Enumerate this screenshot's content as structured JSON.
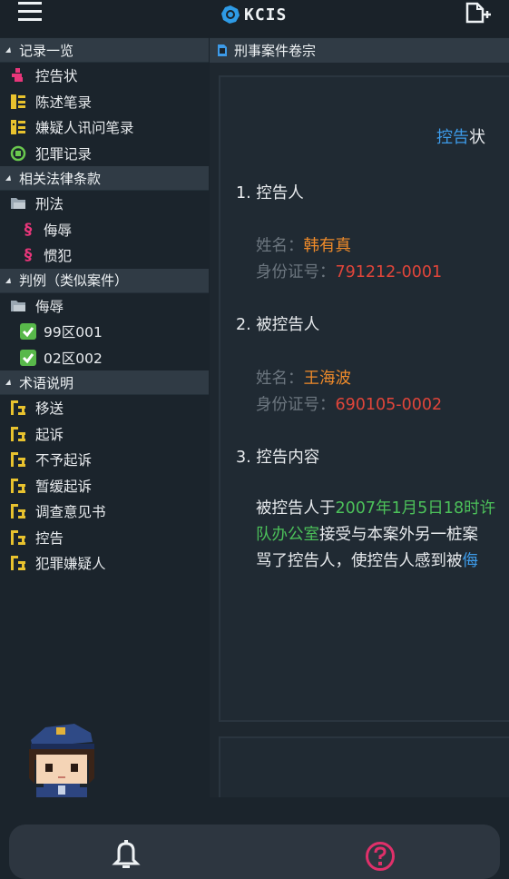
{
  "app": {
    "logo_text": "KCIS"
  },
  "sidebar": {
    "sections": [
      {
        "title": "记录一览",
        "items": [
          "控告状",
          "陈述笔录",
          "嫌疑人讯问笔录",
          "犯罪记录"
        ]
      },
      {
        "title": "相关法律条款",
        "folder": "刑法",
        "items": [
          "侮辱",
          "惯犯"
        ]
      },
      {
        "title": "判例（类似案件）",
        "folder": "侮辱",
        "items": [
          "99区001",
          "02区002"
        ]
      },
      {
        "title": "术语说明",
        "items": [
          "移送",
          "起诉",
          "不予起诉",
          "暂缓起诉",
          "调查意见书",
          "控告",
          "犯罪嫌疑人"
        ]
      }
    ]
  },
  "content": {
    "header": "刑事案件卷宗",
    "doc_title_a": "控告",
    "doc_title_b": "状",
    "s1": "1. 控告人",
    "s1_name_label": "姓名：",
    "s1_name": "韩有真",
    "s1_id_label": "身份证号：",
    "s1_id": "791212-0001",
    "s2": "2. 被控告人",
    "s2_name_label": "姓名：",
    "s2_name": "王海波",
    "s2_id_label": "身份证号：",
    "s2_id": "690105-0002",
    "s3": "3. 控告内容",
    "p1_a": "被控告人于",
    "p1_b": "2007年1月5日18时许",
    "p2_a": "队办公室",
    "p2_b": "接受与本案外另一桩案",
    "p3_a": "骂了控告人，使控告人感到被",
    "p3_b": "侮"
  },
  "colors": {
    "accent_blue": "#3d9be9",
    "name_orange": "#ee8a2a",
    "id_red": "#e0453a",
    "highlight_green": "#4cc25a",
    "help_pink": "#e0306a"
  },
  "icons": [
    "menu-icon",
    "export-icon",
    "bell-icon",
    "help-icon",
    "folder-icon",
    "section-icon",
    "check-icon",
    "term-icon"
  ]
}
